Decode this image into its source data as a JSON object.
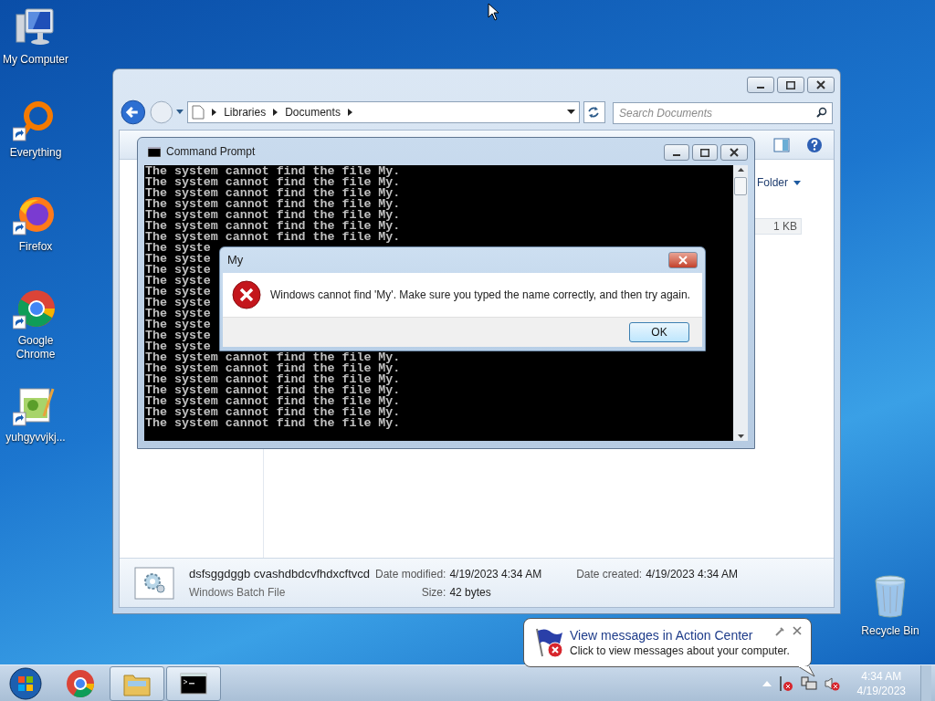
{
  "desktop_icons": [
    {
      "label": "My Computer",
      "kind": "computer",
      "shortcut": false
    },
    {
      "label": "Everything",
      "kind": "ring",
      "shortcut": true
    },
    {
      "label": "Firefox",
      "kind": "fox",
      "shortcut": true
    },
    {
      "label": "Google Chrome",
      "kind": "chrome",
      "shortcut": true
    },
    {
      "label": "yuhgyvvjkj...",
      "kind": "notepad",
      "shortcut": true
    }
  ],
  "recycle_bin": {
    "label": "Recycle Bin"
  },
  "explorer": {
    "breadcrumb": [
      "Libraries",
      "Documents"
    ],
    "search": {
      "placeholder": "Search Documents"
    },
    "arrange_by": "Folder",
    "size_cell": "1 KB",
    "details": {
      "name": "dsfsggdggb cvashdbdcvfhdxcftvcd",
      "type": "Windows Batch File",
      "modified_label": "Date modified:",
      "modified": "4/19/2023 4:34 AM",
      "size_label": "Size:",
      "size": "42 bytes",
      "created_label": "Date created:",
      "created": "4/19/2023 4:34 AM"
    }
  },
  "command_prompt": {
    "title": "Command Prompt",
    "lines": [
      "The system cannot find the file My.",
      "The system cannot find the file My.",
      "The system cannot find the file My.",
      "The system cannot find the file My.",
      "The system cannot find the file My.",
      "The system cannot find the file My.",
      "The system cannot find the file My.",
      "The syste",
      "The syste",
      "The syste",
      "The syste",
      "The syste",
      "The syste",
      "The syste",
      "The syste",
      "The syste",
      "The syste",
      "The system cannot find the file My.",
      "The system cannot find the file My.",
      "The system cannot find the file My.",
      "The system cannot find the file My.",
      "The system cannot find the file My.",
      "The system cannot find the file My.",
      "The system cannot find the file My."
    ]
  },
  "dialog": {
    "title": "My",
    "message": "Windows cannot find 'My'. Make sure you typed the name correctly, and then try again.",
    "button": "OK"
  },
  "notification": {
    "title": "View messages in Action Center",
    "text": "Click to view messages about your computer."
  },
  "taskbar": {
    "apps": [
      {
        "kind": "chrome",
        "running": false
      },
      {
        "kind": "folder",
        "running": true
      },
      {
        "kind": "console",
        "running": true
      }
    ],
    "clock": {
      "time": "4:34 AM",
      "date": "4/19/2023"
    }
  }
}
